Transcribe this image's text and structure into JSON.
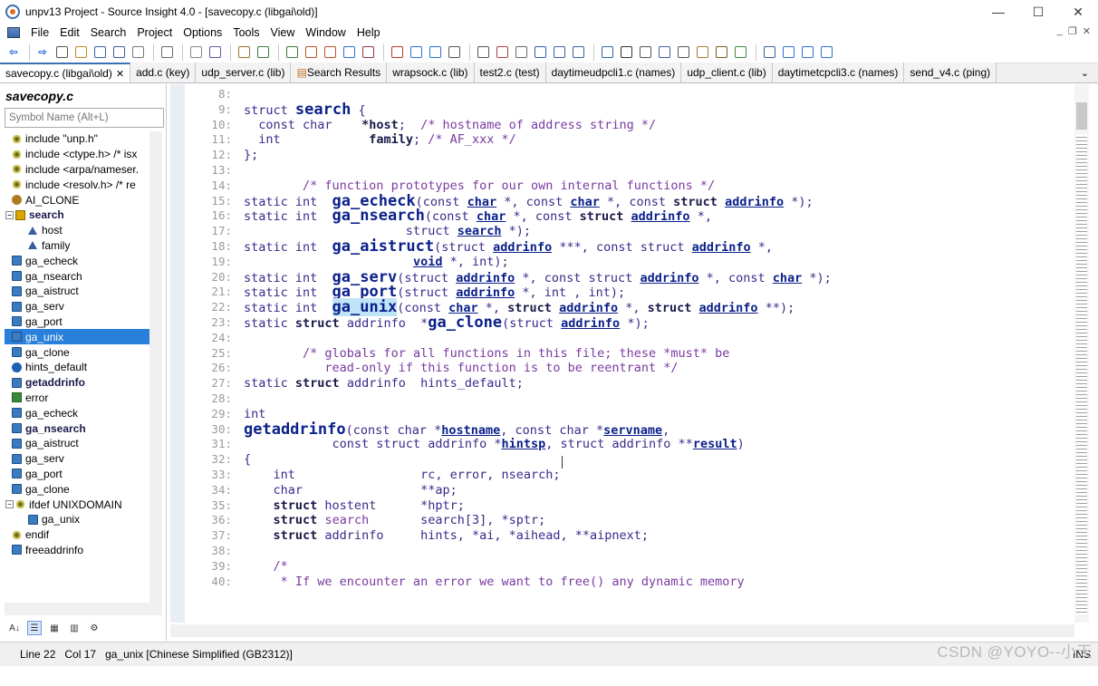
{
  "window": {
    "title": "unpv13 Project - Source Insight 4.0 - [savecopy.c (libgai\\old)]",
    "minimize": "—",
    "maximize": "☐",
    "close": "✕"
  },
  "menu": [
    "File",
    "Edit",
    "Search",
    "Project",
    "Options",
    "Tools",
    "View",
    "Window",
    "Help"
  ],
  "mdi": {
    "min": "_",
    "restore": "❐",
    "close": "✕"
  },
  "toolbar_icons": [
    "back-icon",
    "forward-icon",
    "new-file-icon",
    "open-file-icon",
    "save-icon",
    "save-all-icon",
    "close-file-icon",
    "print-icon",
    "cut-icon",
    "copy-icon",
    "paste-icon",
    "undo-icon",
    "redo-icon",
    "search-icon",
    "replace-icon",
    "lookup-icon",
    "cross-ref-icon",
    "files-icon",
    "bookmark-icon",
    "jump-icon",
    "refs-icon",
    "window-icon",
    "book-icon",
    "browse-icon",
    "symbol-icon",
    "split-icon",
    "tile-icon",
    "cascade-icon",
    "settings-icon",
    "diff-icon",
    "relation-icon",
    "context-icon",
    "project-icon",
    "bird-icon",
    "hash-icon",
    "grid-icon",
    "plus-minus-icon",
    "indent-icon",
    "outdent-icon"
  ],
  "tabs": [
    {
      "label": "savecopy.c (libgai\\old)",
      "close": "✕",
      "active": true
    },
    {
      "label": "add.c (key)"
    },
    {
      "label": "udp_server.c (lib)"
    },
    {
      "label": "Search Results"
    },
    {
      "label": "wrapsock.c (lib)"
    },
    {
      "label": "test2.c (test)"
    },
    {
      "label": "daytimeudpcli1.c (names)"
    },
    {
      "label": "udp_client.c (lib)"
    },
    {
      "label": "daytimetcpcli3.c (names)"
    },
    {
      "label": "send_v4.c (ping)"
    }
  ],
  "tab_more": "⌄",
  "sidebar": {
    "title": "savecopy.c",
    "search_placeholder": "Symbol Name (Alt+L)"
  },
  "symbols": [
    {
      "label": "include \"unp.h\"",
      "icon": "include-icon"
    },
    {
      "label": "include <ctype.h> /* isx",
      "icon": "include-icon"
    },
    {
      "label": "include <arpa/nameser.",
      "icon": "include-icon"
    },
    {
      "label": "include <resolv.h> /* re",
      "icon": "include-icon"
    },
    {
      "label": "AI_CLONE",
      "icon": "define-icon"
    },
    {
      "label": "search",
      "icon": "struct-icon",
      "bold": true,
      "tree": "−"
    },
    {
      "label": "host",
      "icon": "field-icon",
      "indent": 2
    },
    {
      "label": "family",
      "icon": "field-icon",
      "indent": 2
    },
    {
      "label": "ga_echeck",
      "icon": "function-icon"
    },
    {
      "label": "ga_nsearch",
      "icon": "function-icon"
    },
    {
      "label": "ga_aistruct",
      "icon": "function-icon"
    },
    {
      "label": "ga_serv",
      "icon": "function-icon"
    },
    {
      "label": "ga_port",
      "icon": "function-icon"
    },
    {
      "label": "ga_unix",
      "icon": "function-icon",
      "selected": true
    },
    {
      "label": "ga_clone",
      "icon": "function-icon"
    },
    {
      "label": "hints_default",
      "icon": "variable-icon"
    },
    {
      "label": "getaddrinfo",
      "icon": "function-icon",
      "bold": true
    },
    {
      "label": "error",
      "icon": "label-icon"
    },
    {
      "label": "ga_echeck",
      "icon": "function-icon"
    },
    {
      "label": "ga_nsearch",
      "icon": "function-icon",
      "bold": true
    },
    {
      "label": "ga_aistruct",
      "icon": "function-icon"
    },
    {
      "label": "ga_serv",
      "icon": "function-icon"
    },
    {
      "label": "ga_port",
      "icon": "function-icon"
    },
    {
      "label": "ga_clone",
      "icon": "function-icon"
    },
    {
      "label": "ifdef UNIXDOMAIN",
      "icon": "include-icon",
      "tree": "−"
    },
    {
      "label": "ga_unix",
      "icon": "function-icon",
      "indent": 2
    },
    {
      "label": "endif",
      "icon": "include-icon"
    },
    {
      "label": "freeaddrinfo",
      "icon": "function-icon"
    }
  ],
  "status": {
    "line": "Line 22",
    "col": "Col 17",
    "symbol": "ga_unix [Chinese Simplified (GB2312)]",
    "ins": "INS"
  },
  "watermark": "CSDN @YOYO--小天",
  "code_lines": [
    {
      "n": "8:"
    },
    {
      "n": "9:",
      "html": "<span class='kw'>struct</span> <span class='big'>search</span> {"
    },
    {
      "n": "10:",
      "html": "  <span class='kw'>const char</span>    <span class='bold'>*host</span>;  <span class='cm'>/* hostname of address string */</span>"
    },
    {
      "n": "11:",
      "html": "  <span class='kw'>int</span>            <span class='bold'>family</span>; <span class='cm'>/* AF_xxx */</span>"
    },
    {
      "n": "12:",
      "html": "};"
    },
    {
      "n": "13:"
    },
    {
      "n": "14:",
      "html": "        <span class='cm'>/* function prototypes for our own internal functions */</span>"
    },
    {
      "n": "15:",
      "html": "static int  <span class='big'>ga_echeck</span>(const <span class='ref'>char</span> *, const <span class='ref'>char</span> *, const <span class='bold'>struct</span> <span class='ref'>addrinfo</span> *);"
    },
    {
      "n": "16:",
      "html": "static int  <span class='big'>ga_nsearch</span>(const <span class='ref'>char</span> *, const <span class='bold'>struct</span> <span class='ref'>addrinfo</span> *,"
    },
    {
      "n": "17:",
      "html": "                      struct <span class='ref'>search</span> *);"
    },
    {
      "n": "18:",
      "html": "static int  <span class='big'>ga_aistruct</span>(struct <span class='ref'>addrinfo</span> ***, const struct <span class='ref'>addrinfo</span> *,"
    },
    {
      "n": "19:",
      "html": "                       <span class='ref'>void</span> *, int);"
    },
    {
      "n": "20:",
      "html": "static int  <span class='big'>ga_serv</span>(struct <span class='ref'>addrinfo</span> *, const struct <span class='ref'>addrinfo</span> *, const <span class='ref'>char</span> *);"
    },
    {
      "n": "21:",
      "html": "static int  <span class='big'>ga_port</span>(struct <span class='ref'>addrinfo</span> *, int , int);"
    },
    {
      "n": "22:",
      "html": "static int  <span class='big hl'>ga_unix</span>(const <span class='ref'>char</span> *, <span class='bold'>struct</span> <span class='ref'>addrinfo</span> *, <span class='bold'>struct</span> <span class='ref'>addrinfo</span> **);"
    },
    {
      "n": "23:",
      "html": "static <span class='bold'>struct</span> addrinfo  *<span class='big'>ga_clone</span>(struct <span class='ref'>addrinfo</span> *);"
    },
    {
      "n": "24:"
    },
    {
      "n": "25:",
      "html": "        <span class='cm'>/* globals for all functions in this file; these *must* be</span>"
    },
    {
      "n": "26:",
      "html": "<span class='cm'>           read-only if this function is to be reentrant */</span>"
    },
    {
      "n": "27:",
      "html": "static <span class='bold'>struct</span> addrinfo  hints_default;"
    },
    {
      "n": "28:"
    },
    {
      "n": "29:",
      "html": "int"
    },
    {
      "n": "30:",
      "html": "<span class='big'>getaddrinfo</span>(const char *<span class='ref'>hostname</span>, const char *<span class='ref'>servname</span>,"
    },
    {
      "n": "31:",
      "html": "            const struct addrinfo *<span class='ref'>hintsp</span>, struct addrinfo **<span class='ref'>result</span>)"
    },
    {
      "n": "32:",
      "html": "{"
    },
    {
      "n": "33:",
      "html": "    int                 rc, error, nsearch;"
    },
    {
      "n": "34:",
      "html": "    char                **ap;"
    },
    {
      "n": "35:",
      "html": "    <span class='bold'>struct</span> hostent      *hptr;"
    },
    {
      "n": "36:",
      "html": "    <span class='bold'>struct</span> <span class='cm'>search</span>       search[3], *sptr;"
    },
    {
      "n": "37:",
      "html": "    <span class='bold'>struct</span> addrinfo     hints, *ai, *aihead, **aipnext;"
    },
    {
      "n": "38:"
    },
    {
      "n": "39:",
      "html": "    <span class='cm'>/*</span>"
    },
    {
      "n": "40:",
      "html": "<span class='cm'>     * If we encounter an error we want to free() any dynamic memory</span>"
    }
  ]
}
